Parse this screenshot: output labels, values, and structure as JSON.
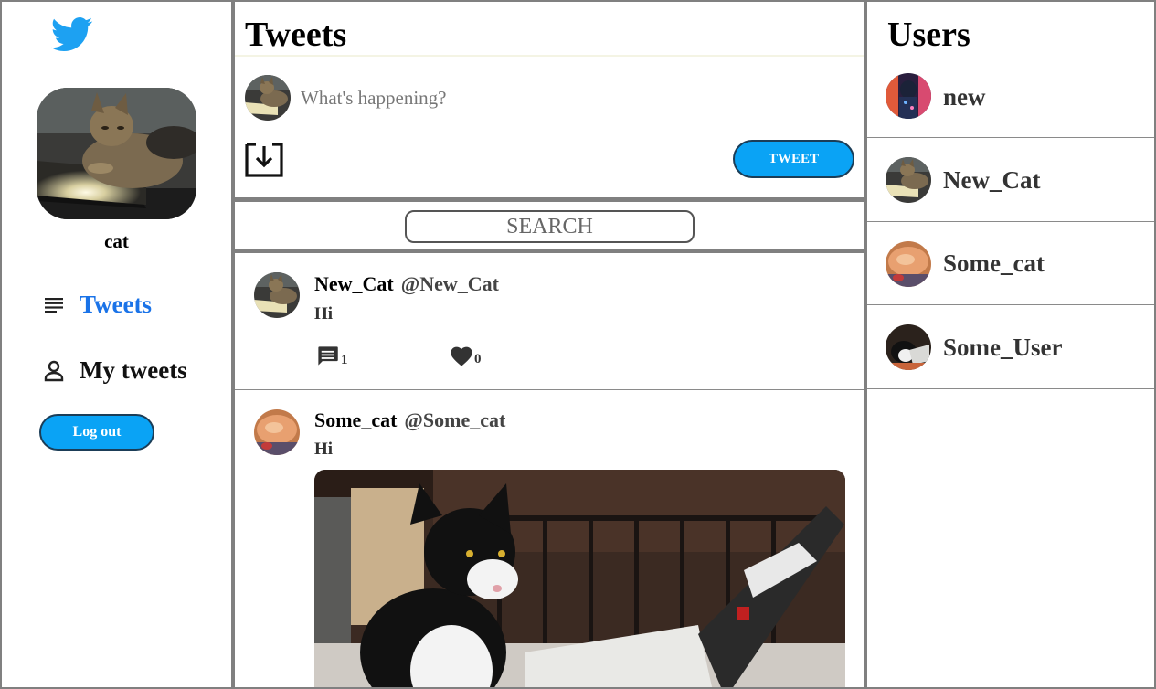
{
  "sidebar": {
    "username": "cat",
    "nav": [
      {
        "label": "Tweets",
        "icon": "list-icon",
        "active": true
      },
      {
        "label": "My tweets",
        "icon": "person-icon",
        "active": false
      }
    ],
    "logout_label": "Log out"
  },
  "main": {
    "title": "Tweets",
    "compose": {
      "placeholder": "What's happening?",
      "tweet_label": "TWEET"
    },
    "search": {
      "placeholder": "SEARCH"
    },
    "tweets": [
      {
        "name": "New_Cat",
        "handle": "@New_Cat",
        "text": "Hi",
        "comments": "1",
        "likes": "0"
      },
      {
        "name": "Some_cat",
        "handle": "@Some_cat",
        "text": "Hi"
      }
    ]
  },
  "users": {
    "title": "Users",
    "list": [
      {
        "name": "new"
      },
      {
        "name": "New_Cat"
      },
      {
        "name": "Some_cat"
      },
      {
        "name": "Some_User"
      }
    ]
  },
  "colors": {
    "accent": "#0aa3f5",
    "nav_active": "#1a73e8",
    "border": "#808080"
  }
}
